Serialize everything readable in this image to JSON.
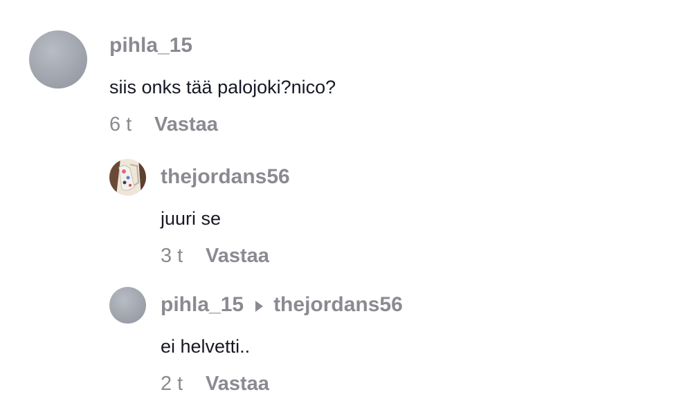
{
  "comments": [
    {
      "username": "pihla_15",
      "text": "siis onks tää palojoki?nico?",
      "time": "6 t",
      "reply_label": "Vastaa"
    },
    {
      "username": "thejordans56",
      "text": "juuri se",
      "time": "3 t",
      "reply_label": "Vastaa"
    },
    {
      "username": "pihla_15",
      "reply_to": "thejordans56",
      "text": "ei helvetti..",
      "time": "2 t",
      "reply_label": "Vastaa"
    }
  ],
  "colors": {
    "username": "#8a8b91",
    "text": "#161823",
    "avatar_default": "#a1a6ae"
  },
  "icons": {
    "reply_to_arrow": "caret-right-icon"
  }
}
